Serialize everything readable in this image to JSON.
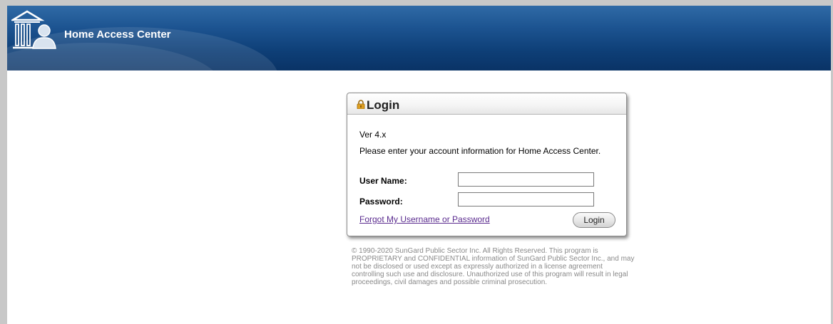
{
  "header": {
    "title": "Home Access Center",
    "logo_icon": "courthouse-person-icon"
  },
  "login": {
    "title": "Login",
    "lock_icon": "lock-icon",
    "version": "Ver 4.x",
    "instructions": "Please enter your account information for Home Access Center.",
    "username_label": "User Name:",
    "username_value": "",
    "password_label": "Password:",
    "password_value": "",
    "forgot_link": "Forgot My Username or Password",
    "submit_label": "Login"
  },
  "footer": {
    "copyright": "© 1990-2020 SunGard Public Sector Inc. All Rights Reserved. This program is PROPRIETARY and CONFIDENTIAL information of SunGard Public Sector Inc., and may not be disclosed or used except as expressly authorized in a license agreement controlling such use and disclosure. Unauthorized use of this program will result in legal proceedings, civil damages and possible criminal prosecution."
  },
  "colors": {
    "header_dark": "#0a3366",
    "header_light": "#2f6aa6",
    "link": "#5b2c8f",
    "copyright_text": "#8a8a8a"
  }
}
